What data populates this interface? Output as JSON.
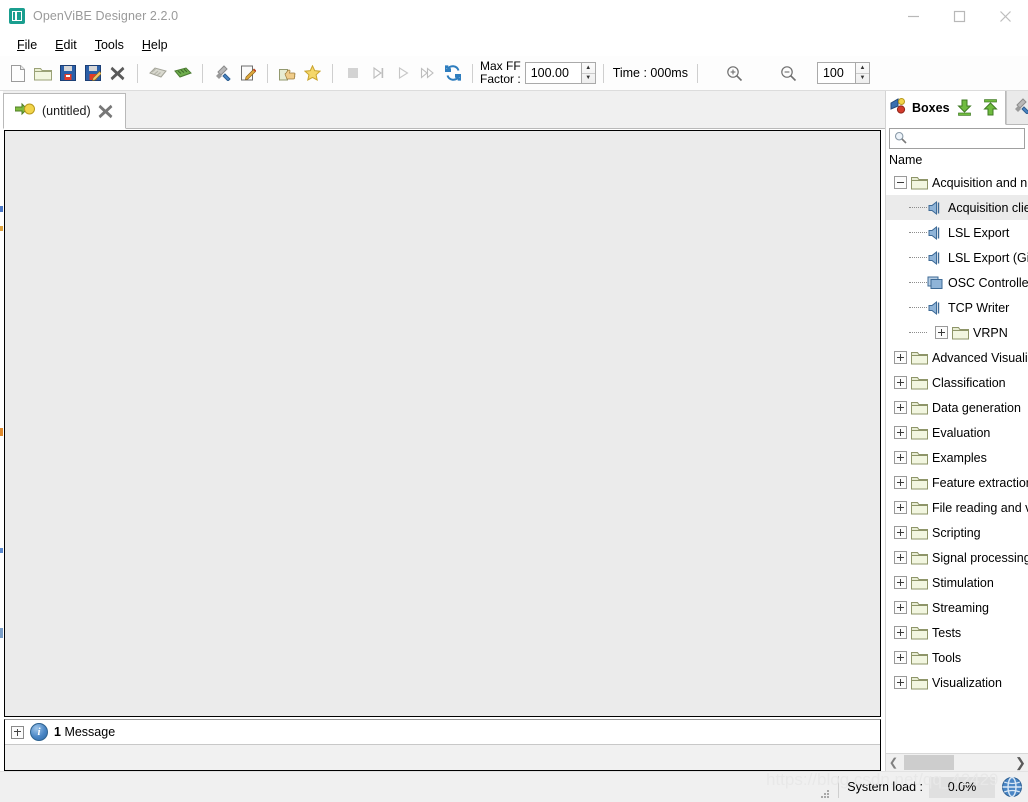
{
  "window": {
    "title": "OpenViBE Designer 2.2.0",
    "app_icon": "openvibe-logo-icon",
    "controls": {
      "minimize": "minimize-icon",
      "maximize": "maximize-icon",
      "close": "close-icon"
    }
  },
  "menu": {
    "items": [
      {
        "label": "File",
        "mnemonic": "F"
      },
      {
        "label": "Edit",
        "mnemonic": "E"
      },
      {
        "label": "Tools",
        "mnemonic": "T"
      },
      {
        "label": "Help",
        "mnemonic": "H"
      }
    ]
  },
  "toolbar": {
    "buttons": [
      {
        "name": "new-scenario-button",
        "icon": "new-document-icon",
        "enabled": true
      },
      {
        "name": "open-scenario-button",
        "icon": "open-folder-icon",
        "enabled": true
      },
      {
        "name": "save-scenario-button",
        "icon": "save-disk-icon",
        "enabled": true
      },
      {
        "name": "save-as-scenario-button",
        "icon": "save-as-disk-icon",
        "enabled": true
      },
      {
        "name": "close-scenario-button",
        "icon": "close-cross-icon",
        "enabled": true
      },
      {
        "name": "undo-button",
        "icon": "undo-arrow-icon",
        "enabled": false
      },
      {
        "name": "redo-button",
        "icon": "redo-arrow-icon",
        "enabled": true
      },
      {
        "name": "configure-scenario-button",
        "icon": "wrench-tools-icon",
        "enabled": true
      },
      {
        "name": "scenario-comment-button",
        "icon": "note-pencil-icon",
        "enabled": true
      },
      {
        "name": "about-scenario-button",
        "icon": "hand-thumb-icon",
        "enabled": true
      },
      {
        "name": "favorite-button",
        "icon": "star-icon",
        "enabled": true
      }
    ],
    "playback": [
      {
        "name": "stop-button",
        "icon": "stop-square-icon",
        "enabled": false
      },
      {
        "name": "step-button",
        "icon": "step-forward-icon",
        "enabled": false
      },
      {
        "name": "play-button",
        "icon": "play-triangle-icon",
        "enabled": false
      },
      {
        "name": "fast-forward-button",
        "icon": "fast-forward-icon",
        "enabled": false
      },
      {
        "name": "reload-button",
        "icon": "reload-refresh-icon",
        "enabled": true
      }
    ],
    "max_ff_factor_label": "Max FF\nFactor :",
    "max_ff_factor_value": "100.00",
    "time_label": "Time : 000ms",
    "zoom_in_icon": "zoom-in-magnifier-icon",
    "zoom_out_icon": "zoom-out-magnifier-icon",
    "zoom_value": "100"
  },
  "scenario_tabs": [
    {
      "label": "(untitled)",
      "icon": "scenario-arrow-icon",
      "close_icon": "close-cross-icon",
      "active": true
    }
  ],
  "messages": {
    "count_text": "1",
    "label": "Message",
    "icon": "info-circle-icon",
    "expander": "expand-plus-icon"
  },
  "boxes_panel": {
    "tab_label": "Boxes",
    "tab_icon": "boxes-palette-icon",
    "import_icon": "download-arrow-icon",
    "export_icon": "upload-arrow-icon",
    "other_tab_icon": "wrench-tools-icon",
    "search_placeholder": "",
    "search_value": "",
    "search_icon": "search-magnifier-icon",
    "column_header": "Name",
    "scroll_left_icon": "chevron-left-icon",
    "scroll_right_icon": "chevron-right-icon",
    "tree": [
      {
        "label": "Acquisition and n",
        "type": "folder",
        "state": "expanded",
        "depth": 0,
        "selected": false
      },
      {
        "label": "Acquisition clie",
        "type": "box",
        "depth": 1,
        "selected": true,
        "icon": "acquisition-box-icon"
      },
      {
        "label": "LSL Export",
        "type": "box",
        "depth": 1,
        "selected": false,
        "icon": "acquisition-box-icon"
      },
      {
        "label": "LSL Export (Gi",
        "type": "box",
        "depth": 1,
        "selected": false,
        "icon": "acquisition-box-icon"
      },
      {
        "label": "OSC Controlle",
        "type": "box",
        "depth": 1,
        "selected": false,
        "icon": "osc-box-icon"
      },
      {
        "label": "TCP Writer",
        "type": "box",
        "depth": 1,
        "selected": false,
        "icon": "acquisition-box-icon"
      },
      {
        "label": "VRPN",
        "type": "folder",
        "state": "collapsed",
        "depth": 1,
        "selected": false
      },
      {
        "label": "Advanced Visuali:",
        "type": "folder",
        "state": "collapsed",
        "depth": 0,
        "selected": false
      },
      {
        "label": "Classification",
        "type": "folder",
        "state": "collapsed",
        "depth": 0,
        "selected": false
      },
      {
        "label": "Data generation",
        "type": "folder",
        "state": "collapsed",
        "depth": 0,
        "selected": false
      },
      {
        "label": "Evaluation",
        "type": "folder",
        "state": "collapsed",
        "depth": 0,
        "selected": false
      },
      {
        "label": "Examples",
        "type": "folder",
        "state": "collapsed",
        "depth": 0,
        "selected": false
      },
      {
        "label": "Feature extractior",
        "type": "folder",
        "state": "collapsed",
        "depth": 0,
        "selected": false
      },
      {
        "label": "File reading and v",
        "type": "folder",
        "state": "collapsed",
        "depth": 0,
        "selected": false
      },
      {
        "label": "Scripting",
        "type": "folder",
        "state": "collapsed",
        "depth": 0,
        "selected": false
      },
      {
        "label": "Signal processing",
        "type": "folder",
        "state": "collapsed",
        "depth": 0,
        "selected": false
      },
      {
        "label": "Stimulation",
        "type": "folder",
        "state": "collapsed",
        "depth": 0,
        "selected": false
      },
      {
        "label": "Streaming",
        "type": "folder",
        "state": "collapsed",
        "depth": 0,
        "selected": false
      },
      {
        "label": "Tests",
        "type": "folder",
        "state": "collapsed",
        "depth": 0,
        "selected": false
      },
      {
        "label": "Tools",
        "type": "folder",
        "state": "collapsed",
        "depth": 0,
        "selected": false
      },
      {
        "label": "Visualization",
        "type": "folder",
        "state": "collapsed",
        "depth": 0,
        "selected": false
      }
    ]
  },
  "statusbar": {
    "system_load_label": "System load :",
    "system_load_value": "0.0%",
    "globe_icon": "globe-network-icon",
    "resize_grip": "resize-grip-icon"
  },
  "watermark": "https://blog.csdn.net/qq_42429",
  "colors": {
    "accent_teal": "#1a9e8f",
    "canvas_bg": "#ebebeb",
    "chrome_bg": "#f0f0f0",
    "selection": "#ebebeb",
    "disabled_text": "#9a9a9a"
  }
}
